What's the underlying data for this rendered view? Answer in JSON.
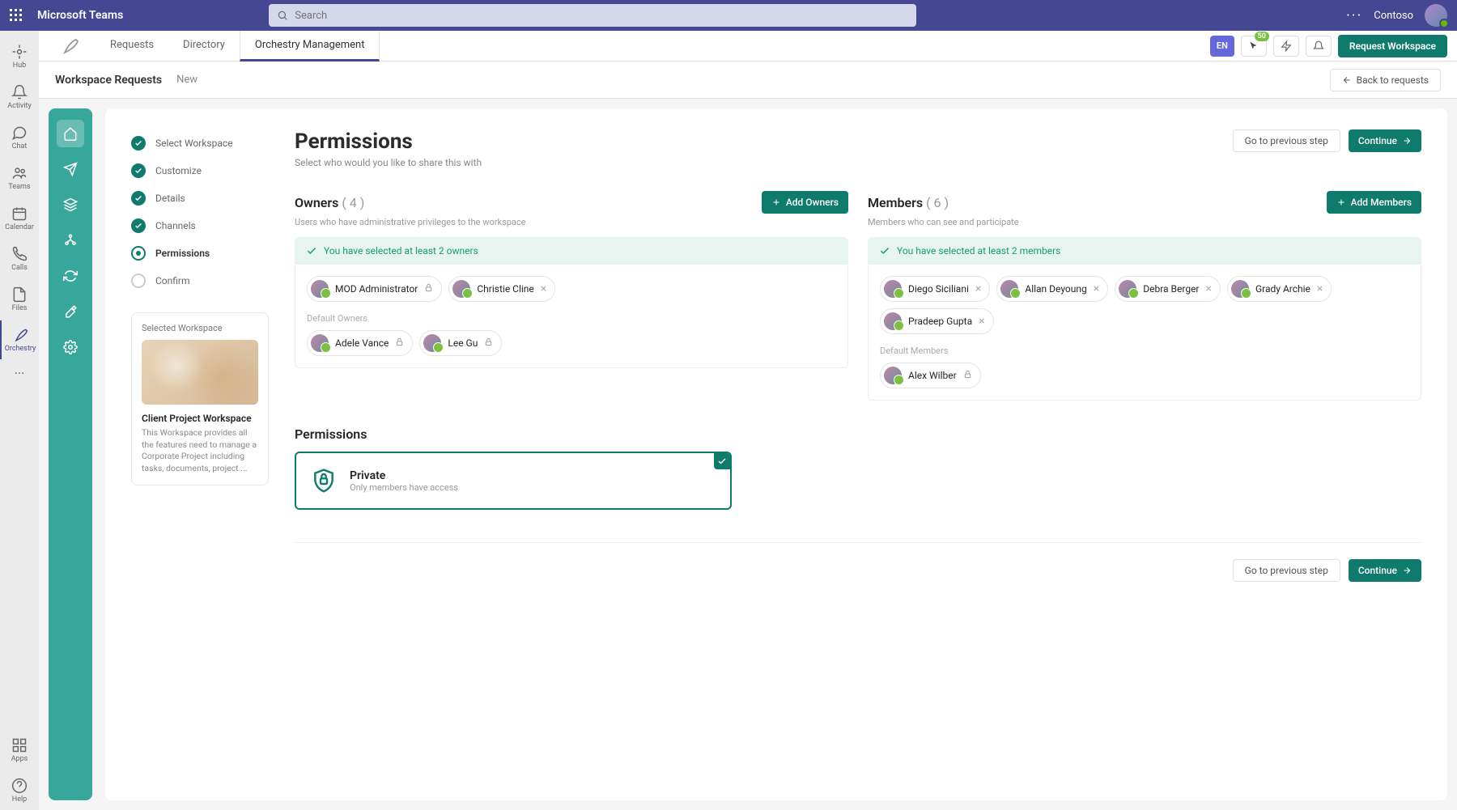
{
  "topbar": {
    "app_title": "Microsoft Teams",
    "search_placeholder": "Search",
    "org": "Contoso"
  },
  "rail": [
    {
      "label": "Hub",
      "icon": "hub"
    },
    {
      "label": "Activity",
      "icon": "bell"
    },
    {
      "label": "Chat",
      "icon": "chat"
    },
    {
      "label": "Teams",
      "icon": "teams"
    },
    {
      "label": "Calendar",
      "icon": "calendar"
    },
    {
      "label": "Calls",
      "icon": "phone"
    },
    {
      "label": "Files",
      "icon": "file"
    },
    {
      "label": "Orchestry",
      "icon": "feather",
      "active": true
    }
  ],
  "rail_bottom": [
    {
      "label": "Apps",
      "icon": "apps"
    },
    {
      "label": "Help",
      "icon": "help"
    }
  ],
  "tabs": [
    {
      "label": "Requests"
    },
    {
      "label": "Directory"
    },
    {
      "label": "Orchestry Management",
      "active": true
    }
  ],
  "toolbar": {
    "lang": "EN",
    "badge": "50",
    "request_btn": "Request Workspace"
  },
  "breadcrumb": {
    "title": "Workspace Requests",
    "current": "New",
    "back": "Back to requests"
  },
  "steps": [
    {
      "label": "Select Workspace",
      "state": "done"
    },
    {
      "label": "Customize",
      "state": "done"
    },
    {
      "label": "Details",
      "state": "done"
    },
    {
      "label": "Channels",
      "state": "done"
    },
    {
      "label": "Permissions",
      "state": "current"
    },
    {
      "label": "Confirm",
      "state": "pending"
    }
  ],
  "selected_workspace": {
    "card_title": "Selected Workspace",
    "name": "Client Project Workspace",
    "desc": "This Workspace provides all the features need to manage a Corporate Project including tasks, documents, project ..."
  },
  "page": {
    "title": "Permissions",
    "subtitle": "Select who would you like to share this with",
    "prev_btn": "Go to previous step",
    "continue_btn": "Continue"
  },
  "owners": {
    "title": "Owners",
    "count": "( 4 )",
    "sub": "Users who have administrative privileges to the workspace",
    "add_btn": "Add Owners",
    "success": "You have selected at least 2 owners",
    "chips": [
      {
        "name": "MOD Administrator",
        "locked": true
      },
      {
        "name": "Christie Cline",
        "removable": true
      }
    ],
    "default_label": "Default Owners",
    "defaults": [
      {
        "name": "Adele Vance",
        "locked": true
      },
      {
        "name": "Lee Gu",
        "locked": true
      }
    ]
  },
  "members": {
    "title": "Members",
    "count": "( 6 )",
    "sub": "Members who can see and participate",
    "add_btn": "Add Members",
    "success": "You have selected at least 2 members",
    "chips": [
      {
        "name": "Diego Siciliani",
        "removable": true
      },
      {
        "name": "Allan Deyoung",
        "removable": true
      },
      {
        "name": "Debra Berger",
        "removable": true
      },
      {
        "name": "Grady Archie",
        "removable": true
      },
      {
        "name": "Pradeep Gupta",
        "removable": true
      }
    ],
    "default_label": "Default Members",
    "defaults": [
      {
        "name": "Alex Wilber",
        "locked": true
      }
    ]
  },
  "permissions": {
    "title": "Permissions",
    "option": {
      "name": "Private",
      "desc": "Only members have access"
    }
  }
}
